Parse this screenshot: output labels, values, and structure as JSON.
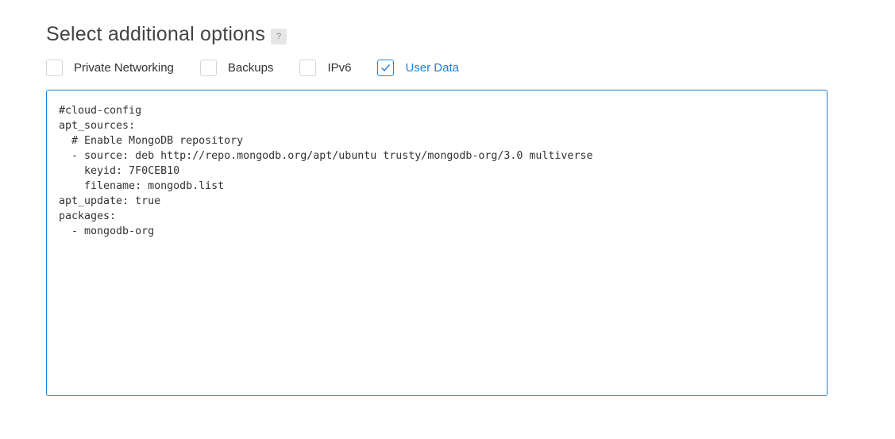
{
  "section": {
    "title": "Select additional options",
    "help": "?"
  },
  "options": [
    {
      "label": "Private Networking",
      "checked": false
    },
    {
      "label": "Backups",
      "checked": false
    },
    {
      "label": "IPv6",
      "checked": false
    },
    {
      "label": "User Data",
      "checked": true
    }
  ],
  "user_data": {
    "value": "#cloud-config\napt_sources:\n  # Enable MongoDB repository\n  - source: deb http://repo.mongodb.org/apt/ubuntu trusty/mongodb-org/3.0 multiverse\n    keyid: 7F0CEB10\n    filename: mongodb.list\napt_update: true\npackages:\n  - mongodb-org"
  },
  "colors": {
    "accent": "#1e7fd8",
    "checkbox_border": "#d4d4d4",
    "title_text": "#444444"
  }
}
